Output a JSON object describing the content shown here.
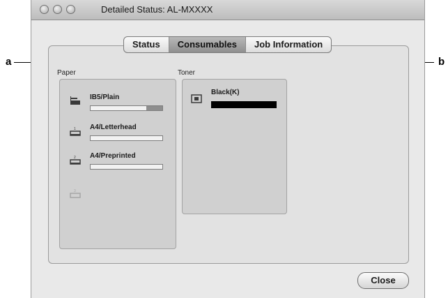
{
  "window": {
    "title": "Detailed Status: AL-MXXXX"
  },
  "tabs": [
    {
      "label": "Status",
      "active": false
    },
    {
      "label": "Consumables",
      "active": true
    },
    {
      "label": "Job Information",
      "active": false
    }
  ],
  "paper": {
    "section_label": "Paper",
    "trays": [
      {
        "label": "IB5/Plain",
        "icon": "multi-purpose-tray-icon",
        "level": 0.78
      },
      {
        "label": "A4/Letterhead",
        "icon": "tray-1-icon",
        "level": 1.0
      },
      {
        "label": "A4/Preprinted",
        "icon": "tray-2-icon",
        "level": 1.0
      },
      {
        "label": "",
        "icon": "tray-3-icon-disabled",
        "level": null
      }
    ]
  },
  "toner": {
    "section_label": "Toner",
    "items": [
      {
        "label": "Black(K)",
        "icon": "toner-cartridge-icon",
        "level": 1.0,
        "color": "#000000"
      }
    ]
  },
  "buttons": {
    "close_label": "Close"
  },
  "callouts": {
    "a": "a",
    "b": "b"
  },
  "colors": {
    "window_bg": "#e9e9e9",
    "panel_bg": "#d0d0d0",
    "active_tab": "#9f9f9f"
  }
}
